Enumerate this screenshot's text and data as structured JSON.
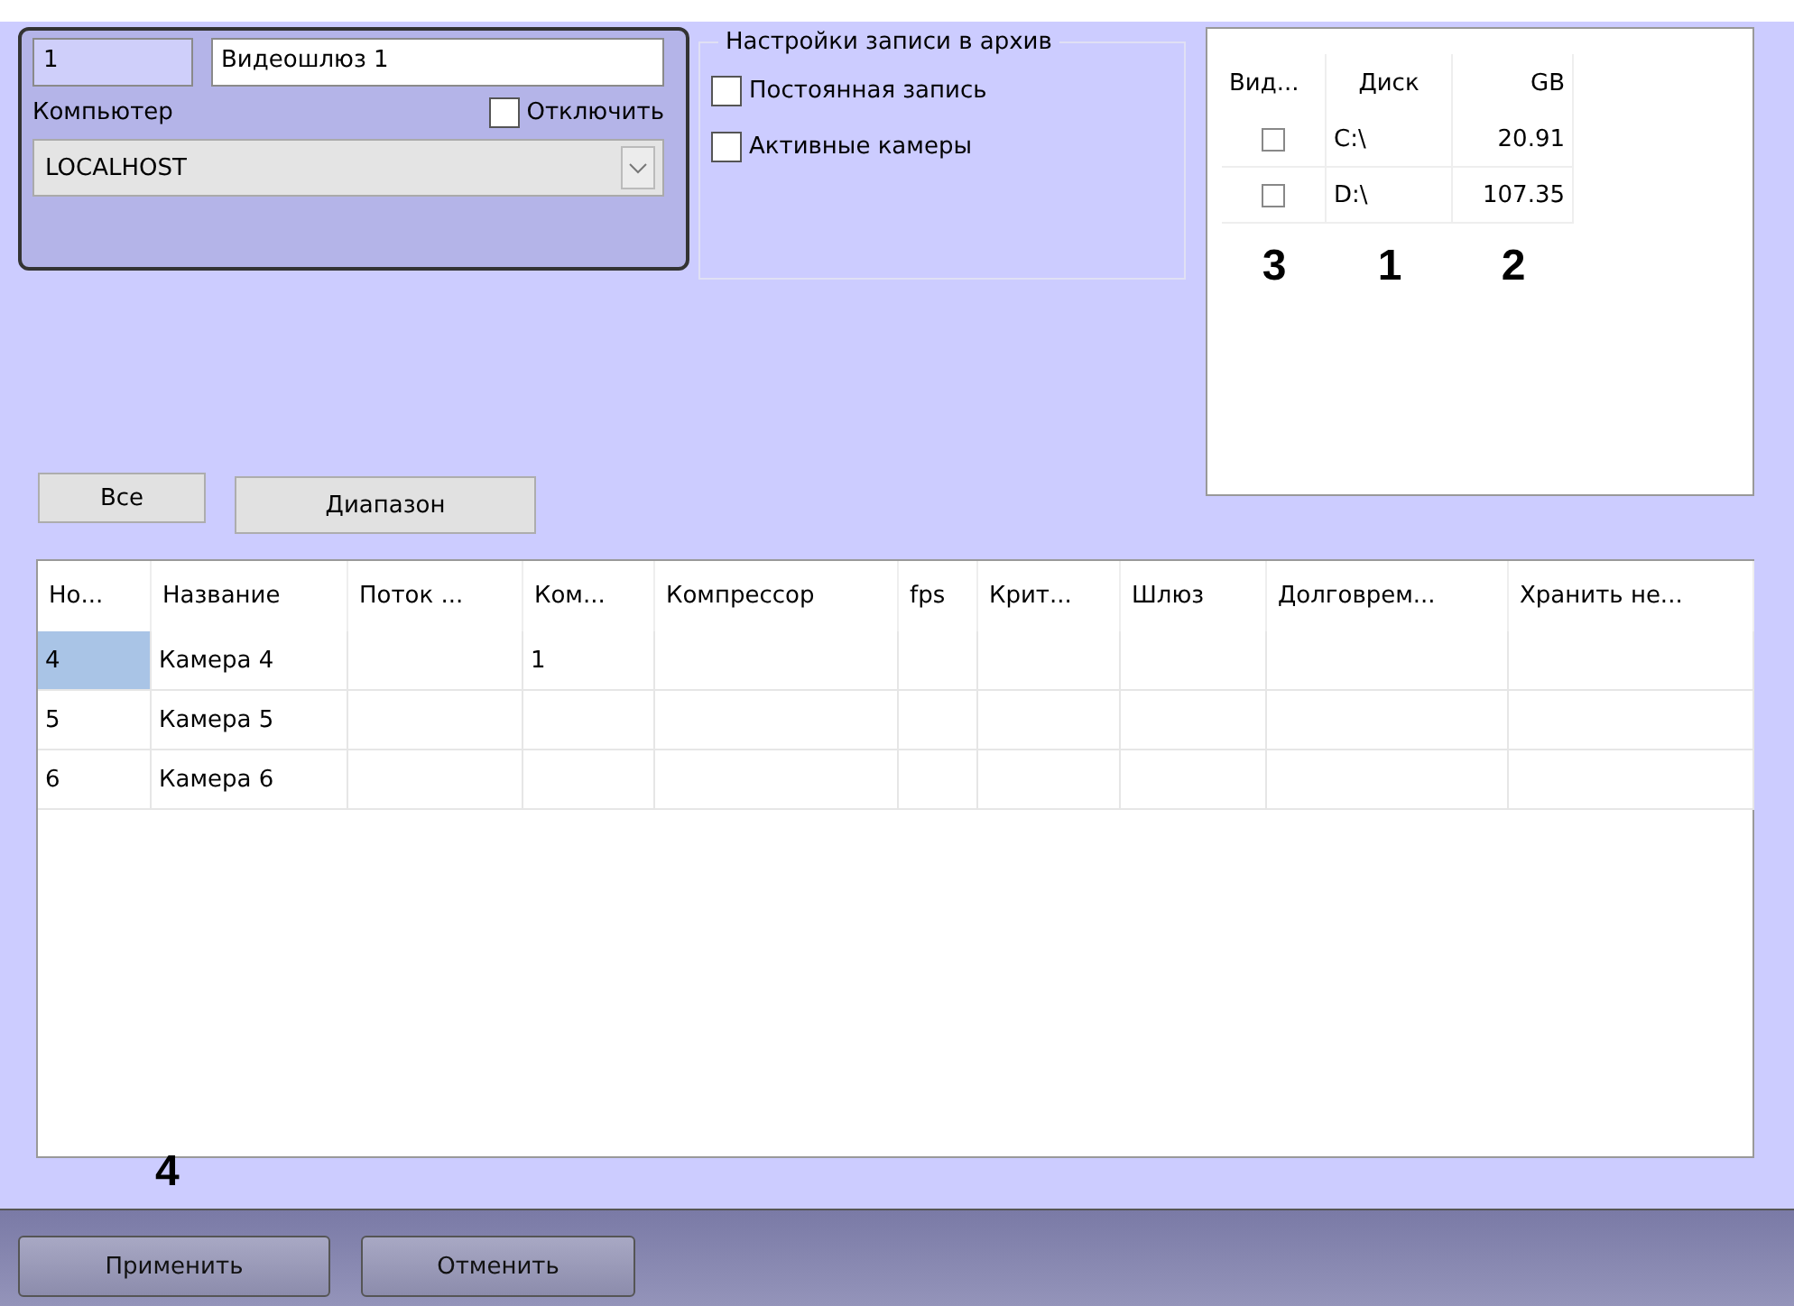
{
  "gateway": {
    "id": "1",
    "name": "Видеошлюз 1",
    "computer_label": "Компьютер",
    "disable": {
      "label": "Отключить",
      "checked": false
    },
    "computer": {
      "value": "LOCALHOST"
    }
  },
  "archive": {
    "title": "Настройки записи в архив",
    "options": [
      {
        "label": "Постоянная запись",
        "checked": false
      },
      {
        "label": "Активные камеры",
        "checked": false
      }
    ]
  },
  "disks": {
    "columns": [
      "Вид...",
      "Диск",
      "GB"
    ],
    "rows": [
      {
        "checked": false,
        "disk": "C:\\",
        "gb": "20.91"
      },
      {
        "checked": false,
        "disk": "D:\\",
        "gb": "107.35"
      }
    ],
    "callouts": [
      "3",
      "1",
      "2"
    ]
  },
  "filter_buttons": [
    "Все",
    "Диапазон"
  ],
  "table": {
    "columns": [
      "Но...",
      "Название",
      "Поток ...",
      "Ком...",
      "Компрессор",
      "fps",
      "Крит...",
      "Шлюз",
      "Долговрем...",
      "Хранить не..."
    ],
    "rows": [
      {
        "selected": true,
        "cells": [
          "4",
          "Камера 4",
          "",
          "1",
          "",
          "",
          "",
          "",
          "",
          ""
        ]
      },
      {
        "selected": false,
        "cells": [
          "5",
          "Камера 5",
          "",
          "",
          "",
          "",
          "",
          "",
          "",
          ""
        ]
      },
      {
        "selected": false,
        "cells": [
          "6",
          "Камера 6",
          "",
          "",
          "",
          "",
          "",
          "",
          "",
          ""
        ]
      }
    ]
  },
  "footer_callout": "4",
  "buttons": [
    "Применить",
    "Отменить"
  ]
}
